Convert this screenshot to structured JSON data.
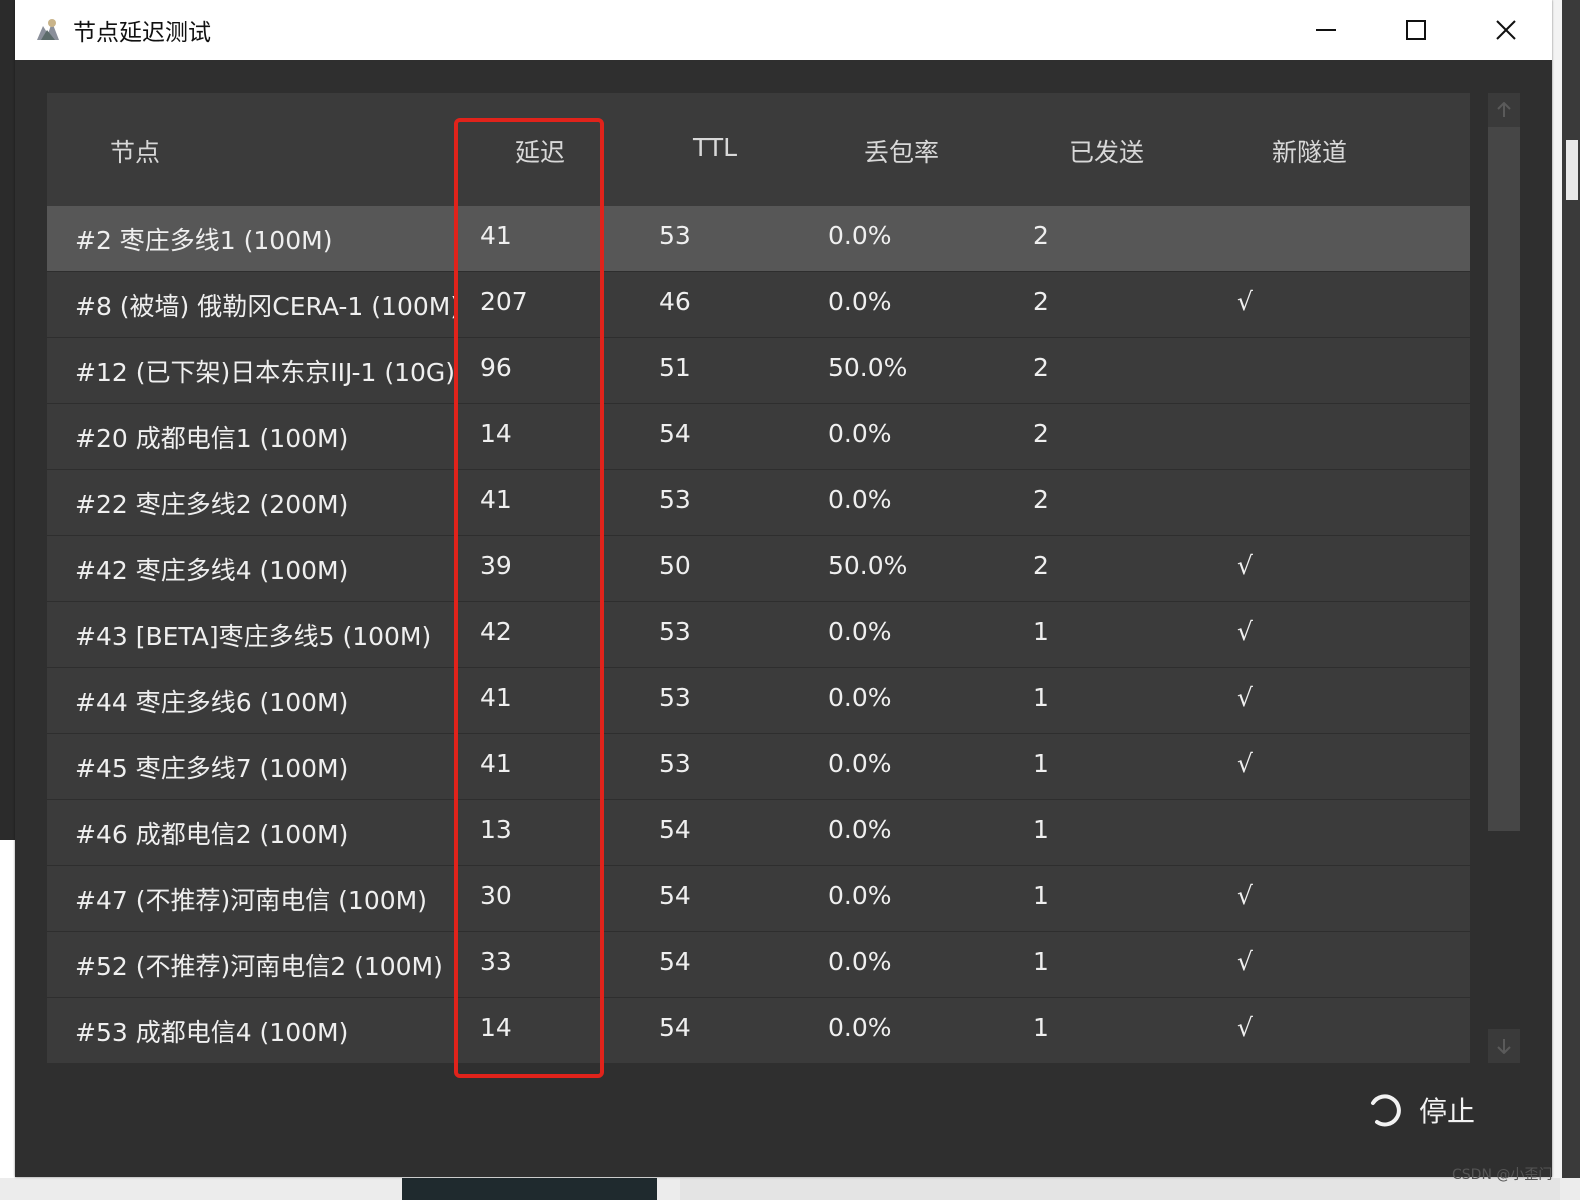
{
  "window": {
    "title": "节点延迟测试",
    "minimize_icon": "minimize-icon",
    "maximize_icon": "maximize-icon",
    "close_icon": "close-icon"
  },
  "table": {
    "headers": [
      "节点",
      "延迟",
      "TTL",
      "丢包率",
      "已发送",
      "新隧道"
    ],
    "selected_row": 0,
    "rows": [
      {
        "node": "#2 枣庄多线1 (100M)",
        "latency": "41",
        "ttl": "53",
        "loss": "0.0%",
        "sent": "2",
        "tunnel": ""
      },
      {
        "node": "#8 (被墙) 俄勒冈CERA-1 (100M)",
        "latency": "207",
        "ttl": "46",
        "loss": "0.0%",
        "sent": "2",
        "tunnel": "√"
      },
      {
        "node": "#12 (已下架)日本东京IIJ-1 (10G)",
        "latency": "96",
        "ttl": "51",
        "loss": "50.0%",
        "sent": "2",
        "tunnel": ""
      },
      {
        "node": "#20 成都电信1 (100M)",
        "latency": "14",
        "ttl": "54",
        "loss": "0.0%",
        "sent": "2",
        "tunnel": ""
      },
      {
        "node": "#22 枣庄多线2 (200M)",
        "latency": "41",
        "ttl": "53",
        "loss": "0.0%",
        "sent": "2",
        "tunnel": ""
      },
      {
        "node": "#42 枣庄多线4 (100M)",
        "latency": "39",
        "ttl": "50",
        "loss": "50.0%",
        "sent": "2",
        "tunnel": "√"
      },
      {
        "node": "#43 [BETA]枣庄多线5 (100M)",
        "latency": "42",
        "ttl": "53",
        "loss": "0.0%",
        "sent": "1",
        "tunnel": "√"
      },
      {
        "node": "#44 枣庄多线6 (100M)",
        "latency": "41",
        "ttl": "53",
        "loss": "0.0%",
        "sent": "1",
        "tunnel": "√"
      },
      {
        "node": "#45 枣庄多线7 (100M)",
        "latency": "41",
        "ttl": "53",
        "loss": "0.0%",
        "sent": "1",
        "tunnel": "√"
      },
      {
        "node": "#46 成都电信2 (100M)",
        "latency": "13",
        "ttl": "54",
        "loss": "0.0%",
        "sent": "1",
        "tunnel": ""
      },
      {
        "node": "#47 (不推荐)河南电信 (100M)",
        "latency": "30",
        "ttl": "54",
        "loss": "0.0%",
        "sent": "1",
        "tunnel": "√"
      },
      {
        "node": "#52 (不推荐)河南电信2 (100M)",
        "latency": "33",
        "ttl": "54",
        "loss": "0.0%",
        "sent": "1",
        "tunnel": "√"
      },
      {
        "node": "#53 成都电信4 (100M)",
        "latency": "14",
        "ttl": "54",
        "loss": "0.0%",
        "sent": "1",
        "tunnel": "√"
      }
    ]
  },
  "footer": {
    "stop_label": "停止",
    "stop_icon": "spinner-icon"
  },
  "watermark": "CSDN @小歪门",
  "colors": {
    "highlight": "#e0231b",
    "panel": "#3b3b3b",
    "selected_row": "#575757"
  }
}
